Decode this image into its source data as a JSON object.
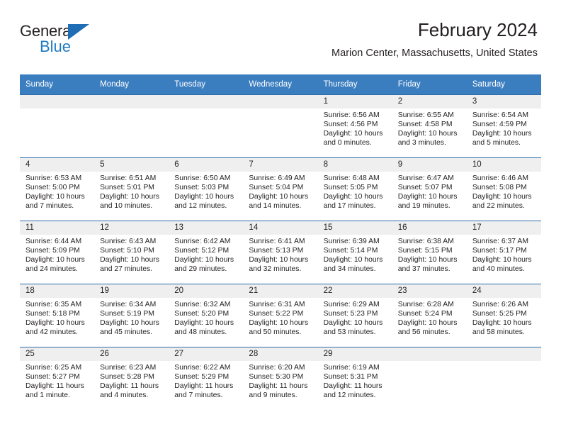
{
  "brand": {
    "name_top": "General",
    "name_bottom": "Blue",
    "triangle_color": "#1f6eb5",
    "blue_text_color": "#1f7ac0"
  },
  "header": {
    "title": "February 2024",
    "subtitle": "Marion Center, Massachusetts, United States"
  },
  "theme": {
    "header_row_bg": "#3b7ec0",
    "header_row_text": "#ffffff",
    "daynum_band_bg": "#efefef",
    "row_border": "#2c6ca8",
    "body_text": "#231f20"
  },
  "weekdays": [
    "Sunday",
    "Monday",
    "Tuesday",
    "Wednesday",
    "Thursday",
    "Friday",
    "Saturday"
  ],
  "weeks": [
    [
      {
        "day": ""
      },
      {
        "day": ""
      },
      {
        "day": ""
      },
      {
        "day": ""
      },
      {
        "day": "1",
        "sunrise": "Sunrise: 6:56 AM",
        "sunset": "Sunset: 4:56 PM",
        "daylight": "Daylight: 10 hours and 0 minutes."
      },
      {
        "day": "2",
        "sunrise": "Sunrise: 6:55 AM",
        "sunset": "Sunset: 4:58 PM",
        "daylight": "Daylight: 10 hours and 3 minutes."
      },
      {
        "day": "3",
        "sunrise": "Sunrise: 6:54 AM",
        "sunset": "Sunset: 4:59 PM",
        "daylight": "Daylight: 10 hours and 5 minutes."
      }
    ],
    [
      {
        "day": "4",
        "sunrise": "Sunrise: 6:53 AM",
        "sunset": "Sunset: 5:00 PM",
        "daylight": "Daylight: 10 hours and 7 minutes."
      },
      {
        "day": "5",
        "sunrise": "Sunrise: 6:51 AM",
        "sunset": "Sunset: 5:01 PM",
        "daylight": "Daylight: 10 hours and 10 minutes."
      },
      {
        "day": "6",
        "sunrise": "Sunrise: 6:50 AM",
        "sunset": "Sunset: 5:03 PM",
        "daylight": "Daylight: 10 hours and 12 minutes."
      },
      {
        "day": "7",
        "sunrise": "Sunrise: 6:49 AM",
        "sunset": "Sunset: 5:04 PM",
        "daylight": "Daylight: 10 hours and 14 minutes."
      },
      {
        "day": "8",
        "sunrise": "Sunrise: 6:48 AM",
        "sunset": "Sunset: 5:05 PM",
        "daylight": "Daylight: 10 hours and 17 minutes."
      },
      {
        "day": "9",
        "sunrise": "Sunrise: 6:47 AM",
        "sunset": "Sunset: 5:07 PM",
        "daylight": "Daylight: 10 hours and 19 minutes."
      },
      {
        "day": "10",
        "sunrise": "Sunrise: 6:46 AM",
        "sunset": "Sunset: 5:08 PM",
        "daylight": "Daylight: 10 hours and 22 minutes."
      }
    ],
    [
      {
        "day": "11",
        "sunrise": "Sunrise: 6:44 AM",
        "sunset": "Sunset: 5:09 PM",
        "daylight": "Daylight: 10 hours and 24 minutes."
      },
      {
        "day": "12",
        "sunrise": "Sunrise: 6:43 AM",
        "sunset": "Sunset: 5:10 PM",
        "daylight": "Daylight: 10 hours and 27 minutes."
      },
      {
        "day": "13",
        "sunrise": "Sunrise: 6:42 AM",
        "sunset": "Sunset: 5:12 PM",
        "daylight": "Daylight: 10 hours and 29 minutes."
      },
      {
        "day": "14",
        "sunrise": "Sunrise: 6:41 AM",
        "sunset": "Sunset: 5:13 PM",
        "daylight": "Daylight: 10 hours and 32 minutes."
      },
      {
        "day": "15",
        "sunrise": "Sunrise: 6:39 AM",
        "sunset": "Sunset: 5:14 PM",
        "daylight": "Daylight: 10 hours and 34 minutes."
      },
      {
        "day": "16",
        "sunrise": "Sunrise: 6:38 AM",
        "sunset": "Sunset: 5:15 PM",
        "daylight": "Daylight: 10 hours and 37 minutes."
      },
      {
        "day": "17",
        "sunrise": "Sunrise: 6:37 AM",
        "sunset": "Sunset: 5:17 PM",
        "daylight": "Daylight: 10 hours and 40 minutes."
      }
    ],
    [
      {
        "day": "18",
        "sunrise": "Sunrise: 6:35 AM",
        "sunset": "Sunset: 5:18 PM",
        "daylight": "Daylight: 10 hours and 42 minutes."
      },
      {
        "day": "19",
        "sunrise": "Sunrise: 6:34 AM",
        "sunset": "Sunset: 5:19 PM",
        "daylight": "Daylight: 10 hours and 45 minutes."
      },
      {
        "day": "20",
        "sunrise": "Sunrise: 6:32 AM",
        "sunset": "Sunset: 5:20 PM",
        "daylight": "Daylight: 10 hours and 48 minutes."
      },
      {
        "day": "21",
        "sunrise": "Sunrise: 6:31 AM",
        "sunset": "Sunset: 5:22 PM",
        "daylight": "Daylight: 10 hours and 50 minutes."
      },
      {
        "day": "22",
        "sunrise": "Sunrise: 6:29 AM",
        "sunset": "Sunset: 5:23 PM",
        "daylight": "Daylight: 10 hours and 53 minutes."
      },
      {
        "day": "23",
        "sunrise": "Sunrise: 6:28 AM",
        "sunset": "Sunset: 5:24 PM",
        "daylight": "Daylight: 10 hours and 56 minutes."
      },
      {
        "day": "24",
        "sunrise": "Sunrise: 6:26 AM",
        "sunset": "Sunset: 5:25 PM",
        "daylight": "Daylight: 10 hours and 58 minutes."
      }
    ],
    [
      {
        "day": "25",
        "sunrise": "Sunrise: 6:25 AM",
        "sunset": "Sunset: 5:27 PM",
        "daylight": "Daylight: 11 hours and 1 minute."
      },
      {
        "day": "26",
        "sunrise": "Sunrise: 6:23 AM",
        "sunset": "Sunset: 5:28 PM",
        "daylight": "Daylight: 11 hours and 4 minutes."
      },
      {
        "day": "27",
        "sunrise": "Sunrise: 6:22 AM",
        "sunset": "Sunset: 5:29 PM",
        "daylight": "Daylight: 11 hours and 7 minutes."
      },
      {
        "day": "28",
        "sunrise": "Sunrise: 6:20 AM",
        "sunset": "Sunset: 5:30 PM",
        "daylight": "Daylight: 11 hours and 9 minutes."
      },
      {
        "day": "29",
        "sunrise": "Sunrise: 6:19 AM",
        "sunset": "Sunset: 5:31 PM",
        "daylight": "Daylight: 11 hours and 12 minutes."
      },
      {
        "day": ""
      },
      {
        "day": ""
      }
    ]
  ]
}
